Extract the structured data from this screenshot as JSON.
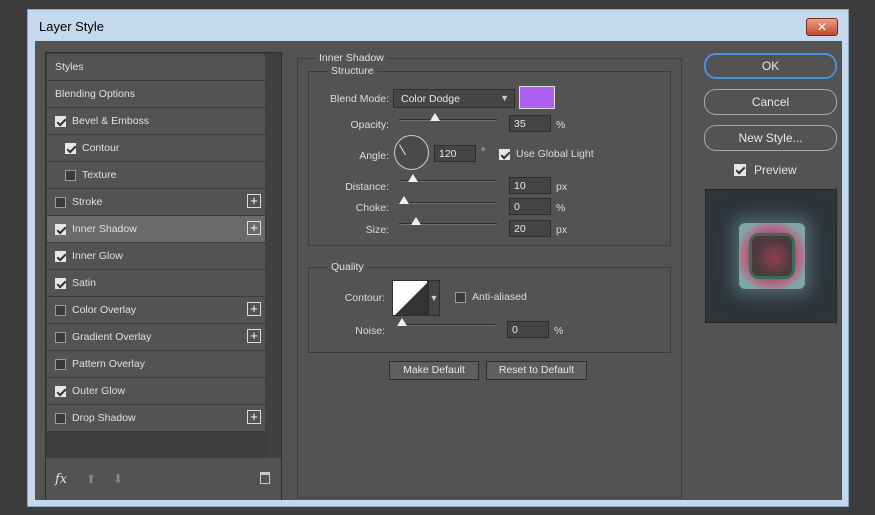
{
  "window": {
    "title": "Layer Style",
    "close_symbol": "✕"
  },
  "styles": {
    "items": [
      {
        "label": "Styles",
        "checkbox": false,
        "checked": false,
        "plus": false,
        "indent": false,
        "active": false
      },
      {
        "label": "Blending Options",
        "checkbox": false,
        "checked": false,
        "plus": false,
        "indent": false,
        "active": false
      },
      {
        "label": "Bevel & Emboss",
        "checkbox": true,
        "checked": true,
        "plus": false,
        "indent": false,
        "active": false
      },
      {
        "label": "Contour",
        "checkbox": true,
        "checked": true,
        "plus": false,
        "indent": true,
        "active": false
      },
      {
        "label": "Texture",
        "checkbox": true,
        "checked": false,
        "plus": false,
        "indent": true,
        "active": false
      },
      {
        "label": "Stroke",
        "checkbox": true,
        "checked": false,
        "plus": true,
        "indent": false,
        "active": false
      },
      {
        "label": "Inner Shadow",
        "checkbox": true,
        "checked": true,
        "plus": true,
        "indent": false,
        "active": true
      },
      {
        "label": "Inner Glow",
        "checkbox": true,
        "checked": true,
        "plus": false,
        "indent": false,
        "active": false
      },
      {
        "label": "Satin",
        "checkbox": true,
        "checked": true,
        "plus": false,
        "indent": false,
        "active": false
      },
      {
        "label": "Color Overlay",
        "checkbox": true,
        "checked": false,
        "plus": true,
        "indent": false,
        "active": false
      },
      {
        "label": "Gradient Overlay",
        "checkbox": true,
        "checked": false,
        "plus": true,
        "indent": false,
        "active": false
      },
      {
        "label": "Pattern Overlay",
        "checkbox": true,
        "checked": false,
        "plus": false,
        "indent": false,
        "active": false
      },
      {
        "label": "Outer Glow",
        "checkbox": true,
        "checked": true,
        "plus": false,
        "indent": false,
        "active": false
      },
      {
        "label": "Drop Shadow",
        "checkbox": true,
        "checked": false,
        "plus": true,
        "indent": false,
        "active": false
      }
    ],
    "footer": {
      "fx": "fx",
      "up_arrow": "⬆",
      "down_arrow": "⬇"
    }
  },
  "inner_shadow": {
    "section_title": "Inner Shadow",
    "structure_title": "Structure",
    "blend_mode": {
      "label": "Blend Mode:",
      "value": "Color Dodge",
      "color": "#b060f0"
    },
    "opacity": {
      "label": "Opacity:",
      "value": "35",
      "unit": "%",
      "fraction": 0.35
    },
    "angle": {
      "label": "Angle:",
      "value": "120",
      "unit": "°",
      "use_global_light": "Use Global Light",
      "use_global_light_checked": true
    },
    "distance": {
      "label": "Distance:",
      "value": "10",
      "unit": "px",
      "fraction": 0.1
    },
    "choke": {
      "label": "Choke:",
      "value": "0",
      "unit": "%",
      "fraction": 0.0
    },
    "size": {
      "label": "Size:",
      "value": "20",
      "unit": "px",
      "fraction": 0.14
    },
    "quality_title": "Quality",
    "contour": {
      "label": "Contour:",
      "anti_aliased": "Anti-aliased",
      "anti_aliased_checked": false
    },
    "noise": {
      "label": "Noise:",
      "value": "0",
      "unit": "%",
      "fraction": 0.0
    },
    "make_default": "Make Default",
    "reset_default": "Reset to Default"
  },
  "actions": {
    "ok": "OK",
    "cancel": "Cancel",
    "new_style": "New Style...",
    "preview_label": "Preview",
    "preview_checked": true
  }
}
